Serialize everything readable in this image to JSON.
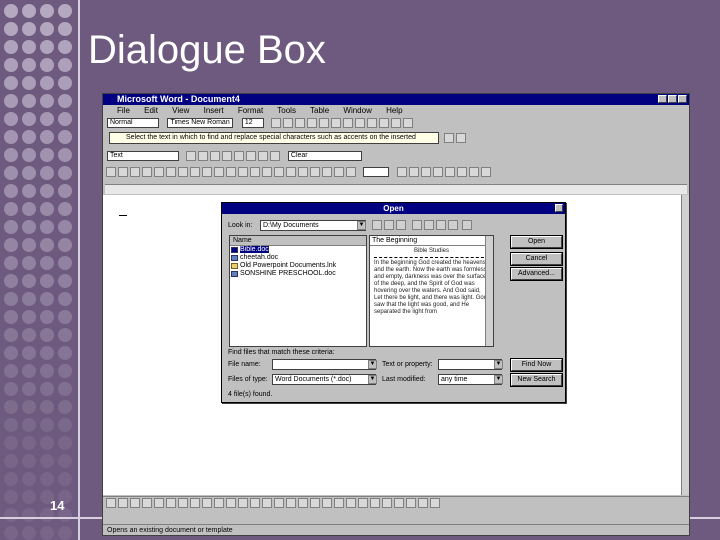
{
  "slide": {
    "title": "Dialogue Box",
    "page_number": "14"
  },
  "word": {
    "window_title": "Microsoft Word - Document4",
    "menus": [
      "File",
      "Edit",
      "View",
      "Insert",
      "Format",
      "Tools",
      "Table",
      "Window",
      "Help"
    ],
    "style_value": "Normal",
    "font_value": "Times New Roman",
    "size_value": "12",
    "tip_text": "Select the text in which to find and replace special characters such as accents on the inserted",
    "style2_value": "Text",
    "size2_value": "Clear",
    "status_text": "Opens an existing document or template"
  },
  "dialog": {
    "title": "Open",
    "look_in_label": "Look in:",
    "look_in_value": "D:\\My Documents",
    "name_header": "Name",
    "files": [
      {
        "name": "Bible.doc",
        "type": "doc",
        "selected": true
      },
      {
        "name": "cheetah.doc",
        "type": "doc",
        "selected": false
      },
      {
        "name": "Old Powerpoint Documents.lnk",
        "type": "folder",
        "selected": false
      },
      {
        "name": "SONSHINE PRESCHOOL.doc",
        "type": "doc",
        "selected": false
      }
    ],
    "preview_title": "The Beginning",
    "preview_subtitle": "Bible Studies",
    "preview_text": "In the beginning God created the heavens and the earth. Now the earth was formless and empty, darkness was over the surface of the deep, and the Spirit of God was hovering over the waters. And God said, Let there be light, and there was light. God saw that the light was good, and He separated the light from",
    "buttons": {
      "open": "Open",
      "cancel": "Cancel",
      "advanced": "Advanced...",
      "find_now": "Find Now",
      "new_search": "New Search"
    },
    "find_label": "Find files that match these criteria:",
    "file_name_label": "File name:",
    "file_name_value": "",
    "files_of_type_label": "Files of type:",
    "files_of_type_value": "Word Documents (*.doc)",
    "text_property_label": "Text or property:",
    "text_property_value": "",
    "last_modified_label": "Last modified:",
    "last_modified_value": "any time",
    "status": "4 file(s) found."
  }
}
